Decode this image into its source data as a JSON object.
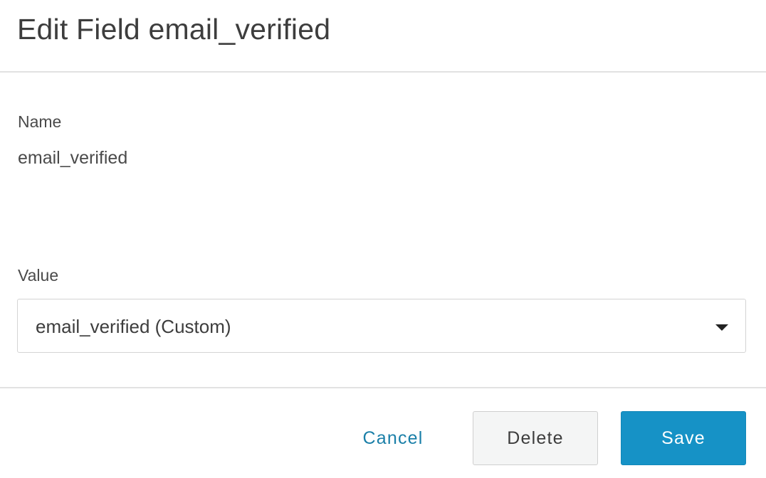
{
  "dialog": {
    "title": "Edit Field email_verified"
  },
  "fields": {
    "name": {
      "label": "Name",
      "value": "email_verified"
    },
    "value": {
      "label": "Value",
      "selected": "email_verified (Custom)"
    }
  },
  "footer": {
    "cancel_label": "Cancel",
    "delete_label": "Delete",
    "save_label": "Save"
  },
  "colors": {
    "accent": "#1692c6",
    "link": "#1a7fa8"
  },
  "icons": {
    "dropdown": "caret-down-icon"
  }
}
